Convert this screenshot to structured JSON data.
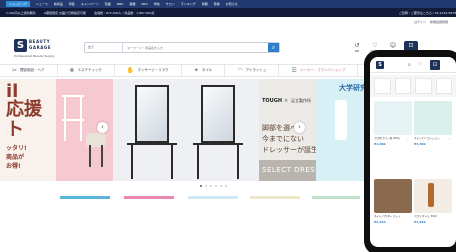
{
  "top_nav": {
    "items": [
      "ショッピング",
      "ニュース",
      "新商品",
      "特集",
      "キャンペーン",
      "知識",
      "MBA",
      "薬機",
      "PRO",
      "学校",
      "サロン",
      "ランキング",
      "特典",
      "登録",
      "お知らせ"
    ]
  },
  "sub_nav": {
    "message": "1,000円以上送料無料",
    "notice": "※期間限定 お届け日時指定可能",
    "stats": "会員数 : 672,000人 / 商品数 : 1,867,000点",
    "contact": "ご質問・ご要望はこちら / 03-1234-5678"
  },
  "account": {
    "login": "ログイン",
    "register": "新規会員登録"
  },
  "logo": {
    "mark": "S",
    "name": "BEAUTY GARAGE",
    "tagline": "Professional Beauty Supply"
  },
  "search": {
    "category": "全て",
    "placeholder": "キーワード・商品名を入力"
  },
  "header_icons": {
    "history_label": "履歴",
    "favorites_label": "お気に入り",
    "mypage_label": "マイページ",
    "cart_label": "カート"
  },
  "categories": [
    {
      "icon": "chair-icon",
      "label": "理容用品・ヘア",
      "pink": false
    },
    {
      "icon": "spa-icon",
      "label": "エステティック",
      "pink": false
    },
    {
      "icon": "massage-icon",
      "label": "マッサージ・リラク",
      "pink": false
    },
    {
      "icon": "nail-icon",
      "label": "ネイル",
      "pink": false
    },
    {
      "icon": "eyelash-icon",
      "label": "アイラッシュ",
      "pink": false
    },
    {
      "icon": "brand-icon",
      "label": "メーカー・ブランドショップ",
      "pink": true
    }
  ],
  "banner_left": {
    "line1": "il",
    "line2": "応援",
    "line3": "ト",
    "line4": "ッタリ!",
    "line5": "商品が",
    "line6": "お得!"
  },
  "banner_dresser": {
    "brand1": "TOUGH",
    "cross": "×",
    "brand2": "足立製作所",
    "line1": "脚部を選べる",
    "line2": "今までにない",
    "line3": "ドレッサーが誕生",
    "cta": "SELECT DRESSER"
  },
  "banner_right": {
    "title": "大学研究"
  },
  "carousel": {
    "prev": "‹",
    "next": "›",
    "count": 6,
    "active": 0
  },
  "colors": {
    "nav": "#223a70",
    "subnav": "#111c3a",
    "accent": "#2e7ec8",
    "pink": "#f6c8cf"
  },
  "phone": {
    "mark": "S",
    "products": [
      {
        "name": "プロ用 カラー剤 200g",
        "price": "¥1,980"
      },
      {
        "name": "スキンケア ローション",
        "price": "¥3,300"
      },
      {
        "name": "ネイル パウダー セット",
        "price": "¥2,420"
      },
      {
        "name": "アロマ オイル 30ml",
        "price": "¥1,650"
      }
    ]
  }
}
